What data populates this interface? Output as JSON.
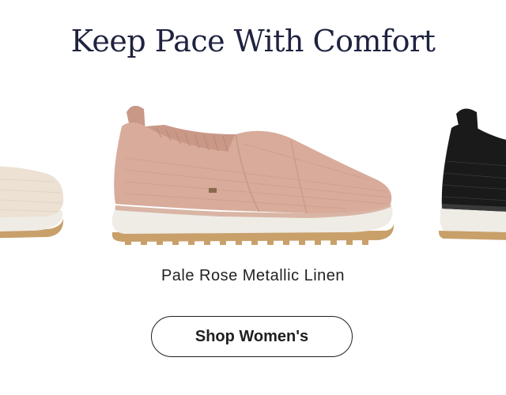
{
  "headline": "Keep Pace With Comfort",
  "carousel": {
    "active_product": {
      "name": "Pale Rose Metallic Linen",
      "color": "#d8ab9b"
    },
    "prev_product": {
      "color": "#ece1d3"
    },
    "next_product": {
      "color": "#1a1a1a"
    }
  },
  "cta": {
    "label": "Shop Women's"
  },
  "colors": {
    "headline_text": "#1f2340",
    "sole": "#efece6",
    "gum_outsole": "#c9a06a"
  }
}
